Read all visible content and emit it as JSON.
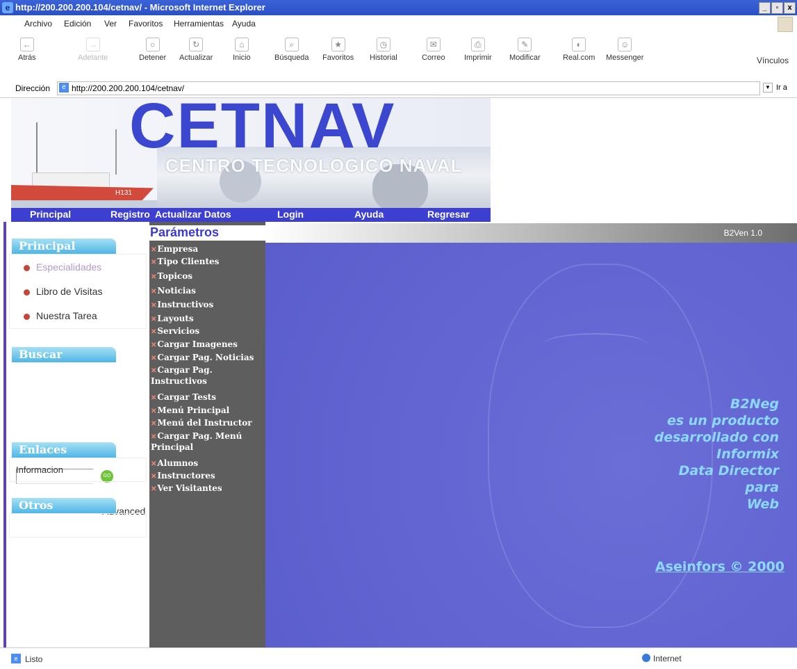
{
  "window": {
    "title": "http://200.200.200.104/cetnav/ - Microsoft Internet Explorer",
    "ie_logo": "e",
    "controls": [
      "_",
      "▫",
      "x"
    ]
  },
  "menubar": {
    "items": [
      "Archivo",
      "Edición",
      "Ver",
      "Favoritos",
      "Herramientas",
      "Ayuda"
    ]
  },
  "toolbar": {
    "buttons": [
      {
        "label": "Atrás",
        "icon": "back-arrow-icon"
      },
      {
        "label": "Adelante",
        "icon": "forward-arrow-icon"
      },
      {
        "label": "Detener",
        "icon": "stop-icon"
      },
      {
        "label": "Actualizar",
        "icon": "refresh-icon"
      },
      {
        "label": "Inicio",
        "icon": "home-icon"
      },
      {
        "label": "Búsqueda",
        "icon": "search-icon"
      },
      {
        "label": "Favoritos",
        "icon": "favorites-icon"
      },
      {
        "label": "Historial",
        "icon": "history-icon"
      },
      {
        "label": "Correo",
        "icon": "mail-icon"
      },
      {
        "label": "Imprimir",
        "icon": "print-icon"
      },
      {
        "label": "Modificar",
        "icon": "edit-icon"
      },
      {
        "label": "Real.com",
        "icon": "realcom-icon"
      },
      {
        "label": "Messenger",
        "icon": "messenger-icon"
      }
    ],
    "links_label": "Vínculos"
  },
  "address": {
    "label": "Dirección",
    "url": "http://200.200.200.104/cetnav/",
    "go_label": "Ir a"
  },
  "banner": {
    "logo": "CETNAV",
    "subtitle": "CENTRO TECNOLOGICO NAVAL",
    "ship_number": "H131"
  },
  "nav": [
    "Principal",
    "Registro",
    "Actualizar Datos",
    "Login",
    "Ayuda",
    "Regresar"
  ],
  "sidebar": {
    "principal": {
      "title": "Principal",
      "items": [
        "Especialidades",
        "Libro de Visitas",
        "Nuestra Tarea"
      ]
    },
    "buscar": {
      "title": "Buscar",
      "go_label": "GO",
      "advanced": "Advanced"
    },
    "enlaces": {
      "title": "Enlaces",
      "items": [
        "Informacion"
      ]
    },
    "otros": {
      "title": "Otros"
    }
  },
  "parametros": {
    "title": "Parámetros",
    "items": [
      "Empresa",
      "Tipo Clientes",
      "Topicos",
      "Noticias",
      "Instructivos",
      "Layouts",
      "Servicios",
      "Cargar Imagenes",
      "Cargar Pag. Noticias",
      "Cargar Pag. Instructivos",
      "Cargar Tests",
      "Menú Principal",
      "Menú del Instructor",
      "Cargar Pag. Menú Principal",
      "Alumnos",
      "Instructores",
      "Ver Visitantes"
    ]
  },
  "main": {
    "version": "B2Ven 1.0",
    "info_lines": [
      "B2Neg",
      "es un producto",
      "desarrollado con",
      "Informix",
      "Data Director",
      "para",
      "Web"
    ],
    "copyright": "Aseinfors © 2000"
  },
  "status": {
    "text": "Listo",
    "zone": "Internet"
  }
}
